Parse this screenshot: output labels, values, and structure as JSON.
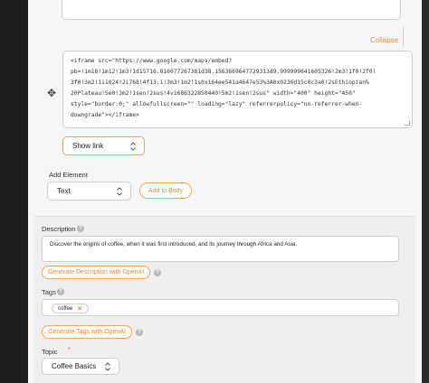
{
  "section": {
    "collapse_label": "Collapse",
    "embed_code_lines": [
      "<iframe src=\"https://www.google.com/maps/embed?",
      "pb=!1m18!1m12!1m3!1d15716.816077267381d38.1563669647729313d9.999999641605326!2m3!1f0!2f0!",
      "3f0!3m2!1i1024!2i768!4f13.1!3m3!1m2!1s0x164ee541a4647e53%3A0x0236d15c0c3a0!2sEthiopian%",
      "20Plateau!5e0!3m2!1sen!2sus!4v1686322850440!5m2!1sen!2sus\" width=\"400\" height=\"450\"",
      "style=\"border:0;\" allowfullscreen=\"\" loading=\"lazy\" referrerpolicy=\"no-referrer-when-",
      "downgrade\"></iframe>"
    ],
    "show_link_value": "Show link"
  },
  "add_element": {
    "label": "Add Element",
    "type_value": "Text",
    "add_button_label": "Add to Body"
  },
  "description": {
    "label": "Description",
    "value": "Discover the origins of coffee, when it was first introduced, and its journey through Africa and Asia.",
    "generate_button_label": "Generate Description with OpenAI"
  },
  "tags": {
    "label": "Tags",
    "items": [
      "coffee"
    ],
    "generate_button_label": "Generate Tags with OpenAI"
  },
  "topic": {
    "label": "Topic",
    "required_mark": "*",
    "value": "Coffee Basics"
  },
  "icons": {
    "drag": "move-handle-icon",
    "chevron": "chevron-up-down-icon",
    "help": "question-circle-icon",
    "remove": "close-icon"
  },
  "colors": {
    "accent": "#e8893a",
    "accent_border": "#f0a35c",
    "sidebar": "#1f1f21"
  }
}
